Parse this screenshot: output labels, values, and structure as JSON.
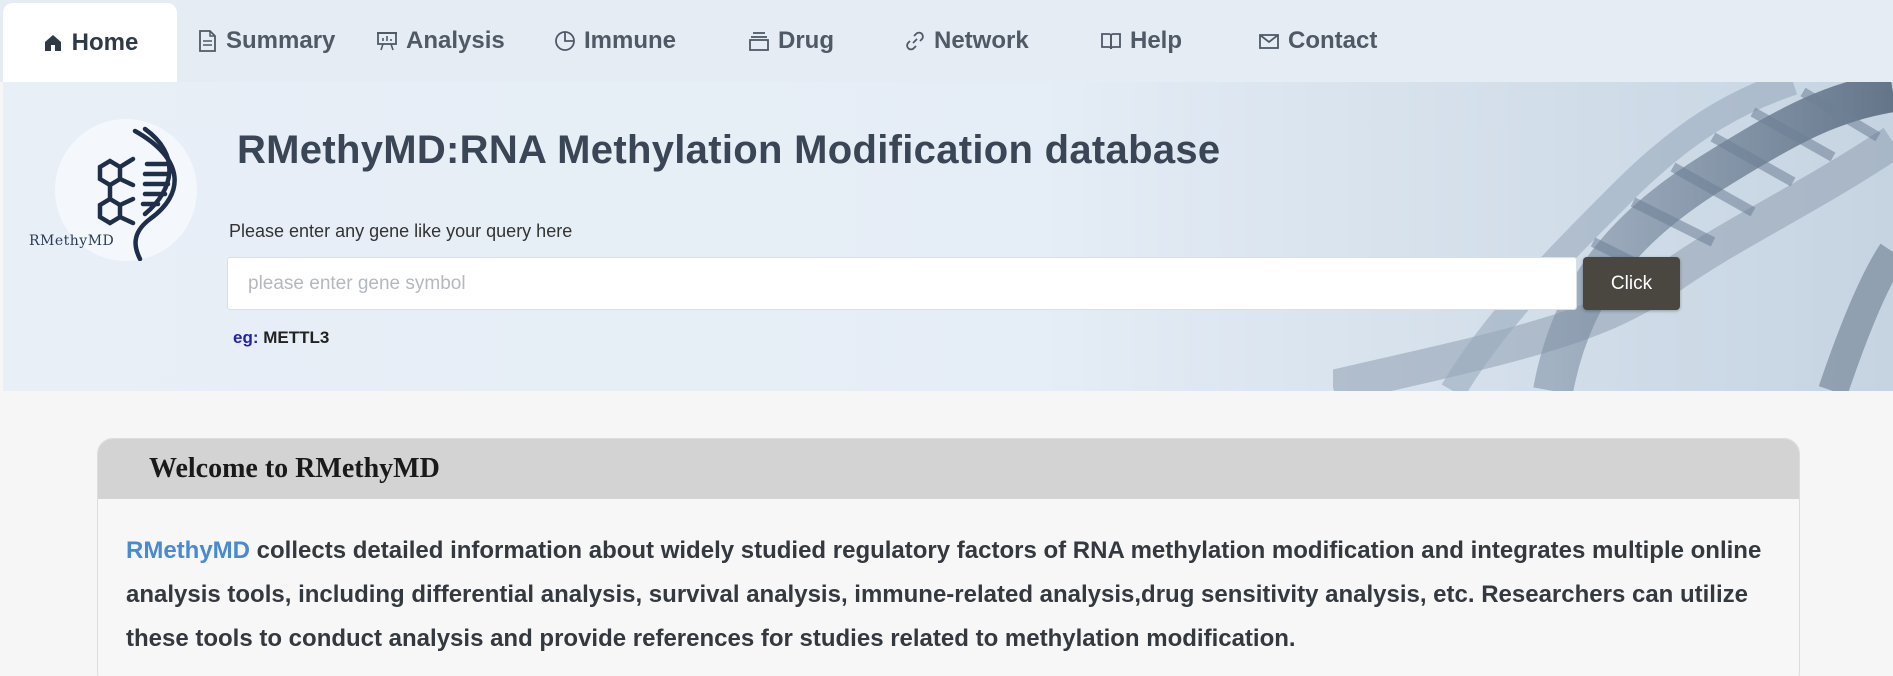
{
  "nav": {
    "items": [
      {
        "label": "Home",
        "icon": "home-icon",
        "active": true
      },
      {
        "label": "Summary",
        "icon": "document-icon"
      },
      {
        "label": "Analysis",
        "icon": "presentation-chart-icon"
      },
      {
        "label": "Immune",
        "icon": "pie-chart-icon"
      },
      {
        "label": "Drug",
        "icon": "archive-box-icon"
      },
      {
        "label": "Network",
        "icon": "link-icon"
      },
      {
        "label": "Help",
        "icon": "book-icon"
      },
      {
        "label": "Contact",
        "icon": "mail-icon"
      }
    ]
  },
  "hero": {
    "logo_text": "RMethyMD",
    "title": "RMethyMD:RNA Methylation Modification database",
    "prompt": "Please enter any gene like your query here",
    "search_placeholder": "please enter gene symbol",
    "search_value": "",
    "button_label": "Click",
    "example_key": "eg:",
    "example_value": "METTL3"
  },
  "welcome": {
    "title": "Welcome to RMethyMD",
    "brand": "RMethyMD",
    "description": " collects detailed information about widely studied regulatory factors of RNA methylation modification and integrates multiple online analysis tools, including differential analysis, survival analysis, immune-related analysis,drug sensitivity analysis, etc. Researchers can utilize these tools to conduct analysis and provide references for studies related to methylation modification."
  },
  "colors": {
    "nav_bg": "#e6ecf4",
    "brand_link": "#4a8ad0",
    "button_bg": "#4a4640",
    "example_key": "#2323a8"
  }
}
